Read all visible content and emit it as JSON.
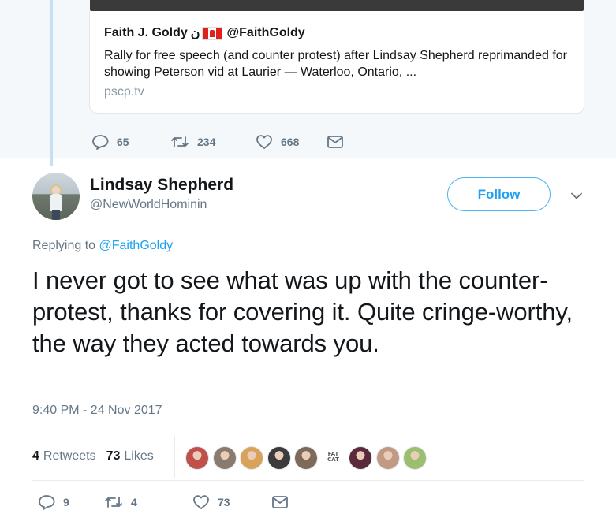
{
  "parent_tweet": {
    "card": {
      "author_name": "Faith J. Goldy",
      "author_glyph": "ن",
      "author_handle": "@FaithGoldy",
      "text": "Rally for free speech (and counter protest) after Lindsay Shepherd reprimanded for showing Peterson vid at Laurier — Waterloo, Ontario, ...",
      "domain": "pscp.tv"
    },
    "actions": {
      "replies": "65",
      "retweets": "234",
      "likes": "668"
    }
  },
  "tweet": {
    "author_name": "Lindsay Shepherd",
    "author_handle": "@NewWorldHominin",
    "follow_label": "Follow",
    "replying_prefix": "Replying to",
    "replying_handle": "@FaithGoldy",
    "text": "I never got to see what was up with the counter-protest, thanks for covering it. Quite cringe-worthy, the way they acted towards you.",
    "timestamp": "9:40 PM - 24 Nov 2017",
    "stats": {
      "retweets_count": "4",
      "retweets_label": "Retweets",
      "likes_count": "73",
      "likes_label": "Likes"
    },
    "liker_avatars": [
      {
        "name": "liker-1",
        "color": "#c0504a"
      },
      {
        "name": "liker-2",
        "color": "#8a7b6e"
      },
      {
        "name": "liker-3",
        "color": "#d8a25a"
      },
      {
        "name": "liker-4",
        "color": "#3b3b3b"
      },
      {
        "name": "liker-5",
        "color": "#7d6a58"
      },
      {
        "name": "liker-6",
        "label": "FAT\nCAT"
      },
      {
        "name": "liker-7",
        "color": "#5a2a3a"
      },
      {
        "name": "liker-8",
        "color": "#c29a84"
      },
      {
        "name": "liker-9",
        "color": "#9bbf6e"
      }
    ],
    "actions": {
      "replies": "9",
      "retweets": "4",
      "likes": "73"
    }
  },
  "colors": {
    "accent": "#1da1f2",
    "muted": "#657786",
    "thread_line": "#c4e0f7",
    "parent_bg": "#f5f8fa"
  },
  "icons": [
    "reply-icon",
    "retweet-icon",
    "like-icon",
    "direct-message-icon",
    "chevron-down-icon",
    "canada-flag-icon"
  ]
}
